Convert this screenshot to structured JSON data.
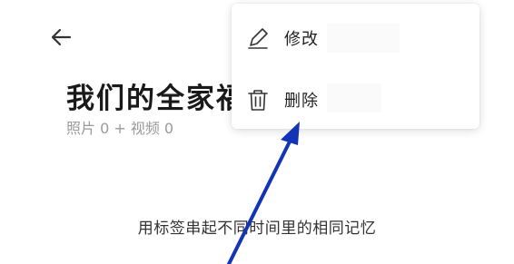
{
  "header": {
    "back_icon": "back-arrow-icon"
  },
  "album": {
    "title": "我们的全家福",
    "meta": "照片 0 + 视频 0"
  },
  "empty_state": {
    "hint": "用标签串起不同时间里的相同记忆"
  },
  "menu": {
    "items": [
      {
        "icon": "pencil-icon",
        "label": "修改"
      },
      {
        "icon": "trash-icon",
        "label": "删除"
      }
    ]
  },
  "annotation": {
    "arrow_color": "#1434b8"
  }
}
